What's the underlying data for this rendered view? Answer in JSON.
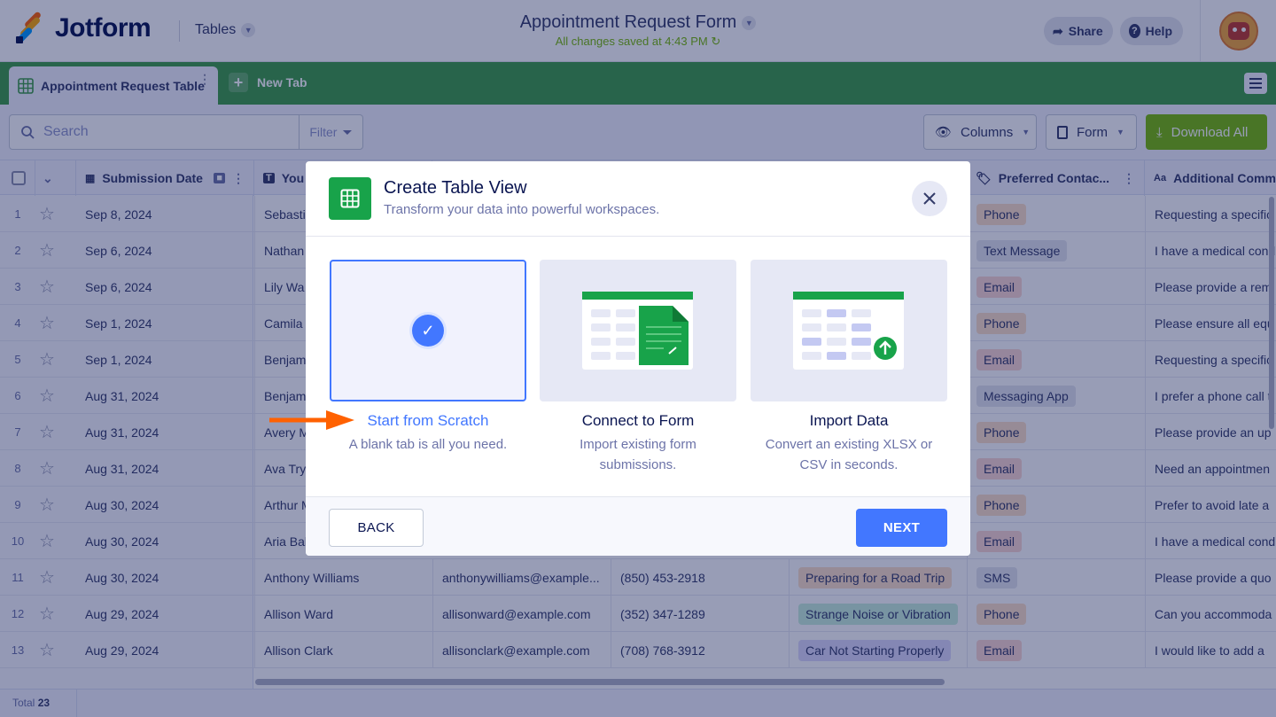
{
  "header": {
    "brand": "Jotform",
    "section": "Tables",
    "form_title": "Appointment Request Form",
    "saved_status": "All changes saved at 4:43 PM",
    "share_label": "Share",
    "help_label": "Help"
  },
  "tabs": {
    "active_label": "Appointment Request Table",
    "new_tab_label": "New Tab"
  },
  "toolbar": {
    "search_placeholder": "Search",
    "filter_label": "Filter",
    "columns_label": "Columns",
    "form_label": "Form",
    "download_label": "Download All"
  },
  "table": {
    "columns": [
      "Submission Date",
      "You",
      "Preferred Contac...",
      "Additional Comm"
    ],
    "rows": [
      {
        "n": "1",
        "date": "Sep 8, 2024",
        "name": "Sebasti",
        "contact": "Phone",
        "comment": "Requesting a specific"
      },
      {
        "n": "2",
        "date": "Sep 6, 2024",
        "name": "Nathan",
        "contact": "Text Message",
        "comment": "I have a medical cond"
      },
      {
        "n": "3",
        "date": "Sep 6, 2024",
        "name": "Lily Wa",
        "contact": "Email",
        "comment": "Please provide a rem"
      },
      {
        "n": "4",
        "date": "Sep 1, 2024",
        "name": "Camila",
        "contact": "Phone",
        "comment": "Please ensure all equ"
      },
      {
        "n": "5",
        "date": "Sep 1, 2024",
        "name": "Benjam",
        "contact": "Email",
        "comment": "Requesting a specific"
      },
      {
        "n": "6",
        "date": "Aug 31, 2024",
        "name": "Benjam",
        "contact": "Messaging App",
        "comment": "I prefer a phone call t"
      },
      {
        "n": "7",
        "date": "Aug 31, 2024",
        "name": "Avery M",
        "contact": "Phone",
        "comment": "Please provide an up"
      },
      {
        "n": "8",
        "date": "Aug 31, 2024",
        "name": "Ava Try",
        "contact": "Email",
        "comment": "Need an appointmen"
      },
      {
        "n": "9",
        "date": "Aug 30, 2024",
        "name": "Arthur M",
        "contact": "Phone",
        "comment": "Prefer to avoid late a"
      },
      {
        "n": "10",
        "date": "Aug 30, 2024",
        "name": "Aria Bal",
        "contact": "Email",
        "comment": "I have a medical cond"
      },
      {
        "n": "11",
        "date": "Aug 30, 2024",
        "name": "Anthony Williams",
        "email": "anthonywilliams@example...",
        "phone": "(850) 453-2918",
        "reason": "Preparing for a Road Trip",
        "contact": "SMS",
        "comment": "Please provide a quo"
      },
      {
        "n": "12",
        "date": "Aug 29, 2024",
        "name": "Allison Ward",
        "email": "allisonward@example.com",
        "phone": "(352) 347-1289",
        "reason": "Strange Noise or Vibration",
        "contact": "Phone",
        "comment": "Can you accommoda"
      },
      {
        "n": "13",
        "date": "Aug 29, 2024",
        "name": "Allison Clark",
        "email": "allisonclark@example.com",
        "phone": "(708) 768-3912",
        "reason": "Car Not Starting Properly",
        "contact": "Email",
        "comment": "I would like to add a"
      }
    ],
    "total_label": "Total",
    "total_value": "23"
  },
  "modal": {
    "title": "Create Table View",
    "subtitle": "Transform your data into powerful workspaces.",
    "options": [
      {
        "title": "Start from Scratch",
        "desc": "A blank tab is all you need."
      },
      {
        "title": "Connect to Form",
        "desc": "Import existing form submissions."
      },
      {
        "title": "Import Data",
        "desc": "Convert an existing XLSX or CSV in seconds."
      }
    ],
    "back_label": "BACK",
    "next_label": "NEXT"
  },
  "colors": {
    "brand_green": "#3f9d47",
    "accent_blue": "#4277ff",
    "download_green": "#78bb07",
    "arrow_orange": "#ff6100"
  }
}
